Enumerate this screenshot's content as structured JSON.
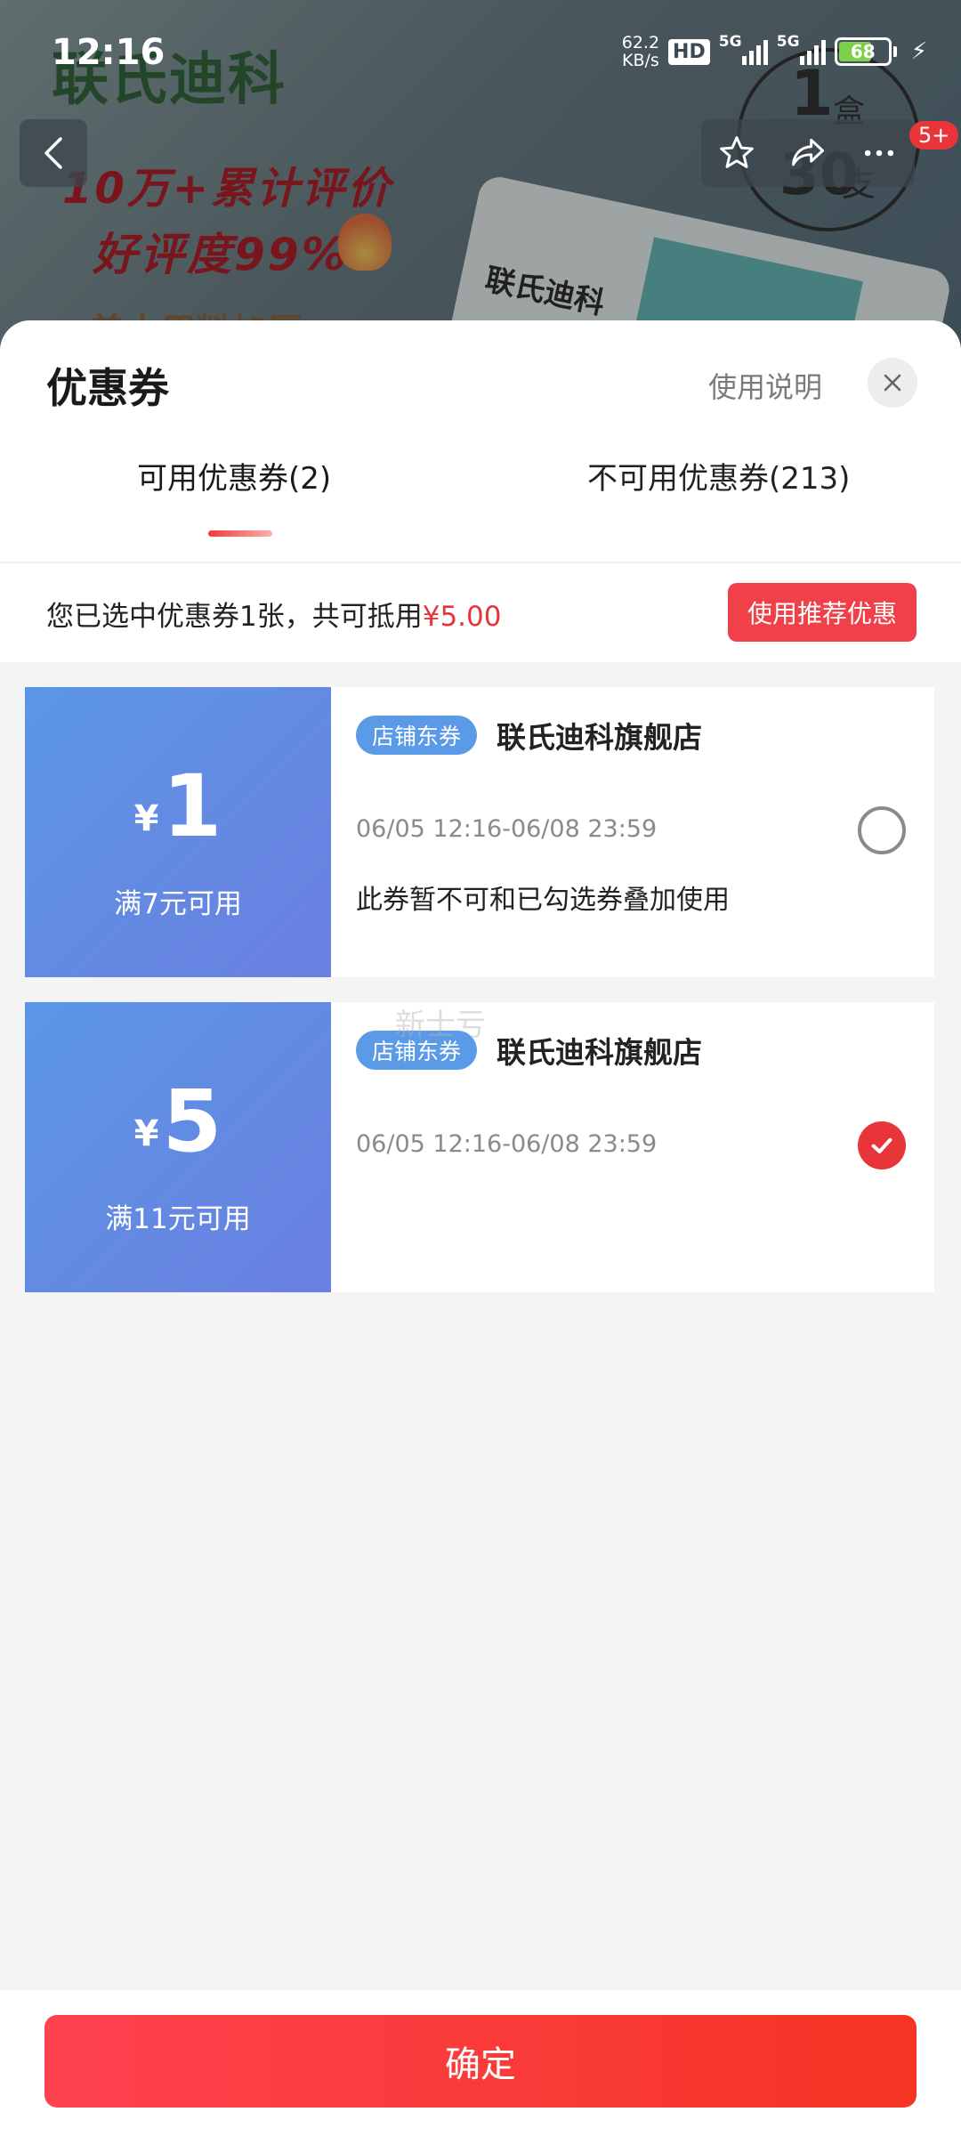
{
  "status_bar": {
    "time": "12:16",
    "net_speed_value": "62.2",
    "net_speed_unit": "KB/s",
    "hd": "HD",
    "signal_1": "5G",
    "signal_2": "5G",
    "battery": "68"
  },
  "product_bg": {
    "brand": "联氏迪科",
    "promo_1": "10万+累计评价",
    "promo_2": "好评度99%",
    "promo_3": "美本用料加厚",
    "box_label": "联氏迪科",
    "badge_count": "1",
    "badge_unit": "盒",
    "badge_qty": "30",
    "badge_qty_unit": "支",
    "cart_badge": "5+"
  },
  "sheet": {
    "title": "优惠券",
    "usage_link": "使用说明",
    "tabs": [
      {
        "label": "可用优惠券(2)"
      },
      {
        "label": "不可用优惠券(213)"
      }
    ],
    "summary_prefix": "您已选中优惠券1张，共可抵用",
    "summary_amount": "¥5.00",
    "recommend_button": "使用推荐优惠"
  },
  "coupons": [
    {
      "currency": "¥",
      "amount": "1",
      "threshold": "满7元可用",
      "tag": "店铺东券",
      "store": "联氏迪科旗舰店",
      "validity": "06/05 12:16-06/08 23:59",
      "note": "此券暂不可和已勾选券叠加使用",
      "selected": false
    },
    {
      "currency": "¥",
      "amount": "5",
      "threshold": "满11元可用",
      "tag": "店铺东券",
      "store": "联氏迪科旗舰店",
      "validity": "06/05 12:16-06/08 23:59",
      "note": "",
      "selected": true
    }
  ],
  "watermark": "新士亏",
  "footer": {
    "confirm": "确定"
  },
  "colors": {
    "accent_red": "#e8353a",
    "coupon_blue": "#5b97e6",
    "tag_blue": "#5a9ae6"
  },
  "icons": [
    "back-arrow-icon",
    "star-icon",
    "share-icon",
    "more-icon",
    "close-icon",
    "check-icon",
    "lightning-icon"
  ]
}
